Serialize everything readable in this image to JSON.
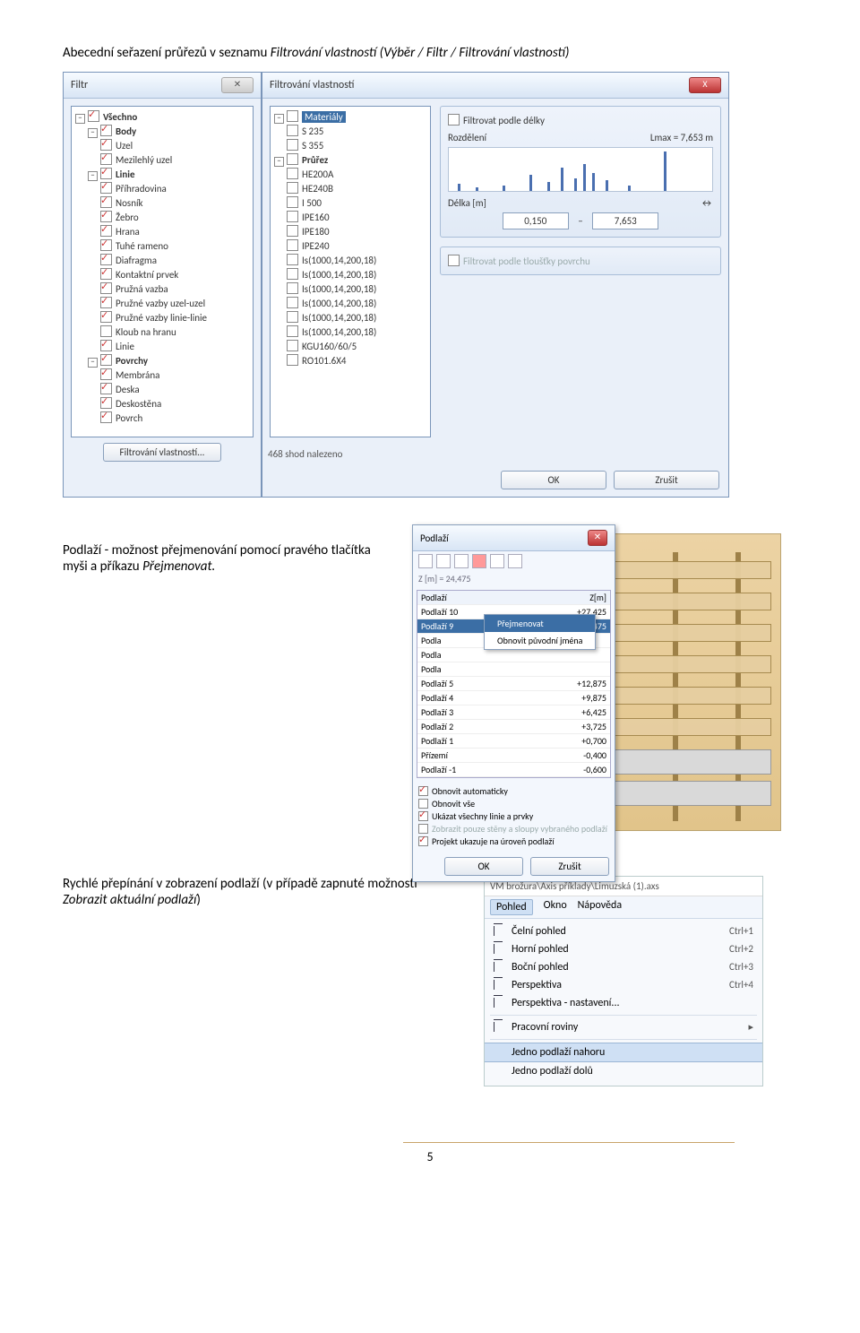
{
  "heading_plain": "Abecední seřazení průřezů v seznamu ",
  "heading_italic": "Filtrování vlastností (Výběr / Filtr / Filtrování vlastností)",
  "filtr_dialog": {
    "title": "Filtr",
    "tree": {
      "root": "Všechno",
      "body": "Body",
      "body_items": [
        "Uzel",
        "Mezilehlý uzel"
      ],
      "linie": "Linie",
      "linie_items": [
        "Příhradovina",
        "Nosník",
        "Žebro",
        "Hrana",
        "Tuhé rameno",
        "Diafragma",
        "Kontaktní prvek",
        "Pružná vazba",
        "Pružné vazby uzel-uzel",
        "Pružné vazby linie-linie",
        "Kloub na hranu",
        "Linie"
      ],
      "povrchy": "Povrchy",
      "povrchy_items": [
        "Membrána",
        "Deska",
        "Deskostěna",
        "Povrch"
      ]
    },
    "button": "Filtrování vlastností..."
  },
  "vlast_dialog": {
    "title": "Filtrování vlastností",
    "close_x": "X",
    "materialy": "Materiály",
    "mat_items": [
      "S 235",
      "S 355"
    ],
    "prurez": "Průřez",
    "prurez_items": [
      "HE200A",
      "HE240B",
      "I 500",
      "IPE160",
      "IPE180",
      "IPE240",
      "Is(1000,14,200,18)",
      "Is(1000,14,200,18)",
      "Is(1000,14,200,18)",
      "Is(1000,14,200,18)",
      "Is(1000,14,200,18)",
      "Is(1000,14,200,18)",
      "KGU160/60/5",
      "RO101.6X4"
    ],
    "status": "468 shod nalezeno",
    "filter_len": "Filtrovat podle délky",
    "rozdeleni": "Rozdělení",
    "lmax_label": "Lmax",
    "lmax_eq": "= 7,653 m",
    "delka": "Délka [m]",
    "d_from": "0,150",
    "d_to": "7,653",
    "dash": "–",
    "filter_thick": "Filtrovat podle tloušťky povrchu",
    "ok": "OK",
    "cancel": "Zrušit"
  },
  "sec2_text1": "Podlaží - možnost přejmenování pomocí pravého tlačítka myši a příkazu ",
  "sec2_text_italic": "Přejmenovat.",
  "podlazi_panel": {
    "title": "Podlaží",
    "z_label": "Z [m] = 24,475",
    "head_name": "Podlaží",
    "head_z": "Z[m]",
    "rows": [
      {
        "n": "Podlaží 10",
        "z": "+27,425"
      },
      {
        "n": "Podlaží 9",
        "z": "+24,475"
      },
      {
        "n": "Podla",
        "z": ""
      },
      {
        "n": "Podla",
        "z": ""
      },
      {
        "n": "Podla",
        "z": ""
      },
      {
        "n": "Podlaží 5",
        "z": "+12,875"
      },
      {
        "n": "Podlaží 4",
        "z": "+9,875"
      },
      {
        "n": "Podlaží 3",
        "z": "+6,425"
      },
      {
        "n": "Podlaží 2",
        "z": "+3,725"
      },
      {
        "n": "Podlaží 1",
        "z": "+0,700"
      },
      {
        "n": "Přízemí",
        "z": "-0,400"
      },
      {
        "n": "Podlaží -1",
        "z": "-0,600"
      }
    ],
    "ctx_rename": "Přejmenovat",
    "ctx_restore": "Obnovit původní jména",
    "opt1": "Obnovit automaticky",
    "opt2": "Obnovit vše",
    "opt3": "Ukázat všechny linie a prvky",
    "opt4": "Zobrazit pouze stěny a sloupy vybraného podlaží",
    "opt5": "Projekt ukazuje na úroveň podlaží",
    "ok": "OK",
    "cancel": "Zrušit"
  },
  "sec3_text1": "Rychlé přepínání v zobrazení podlaží (v případě zapnuté možnosti ",
  "sec3_text_italic": "Zobrazit aktuální podlaží",
  "sec3_text2": ")",
  "menu3": {
    "path": "VM brožura\\Axis příklady\\Limuzská (1).axs",
    "tabs": [
      "Pohled",
      "Okno",
      "Nápověda"
    ],
    "items": [
      {
        "label": "Čelní pohled",
        "sc": "Ctrl+1"
      },
      {
        "label": "Horní pohled",
        "sc": "Ctrl+2"
      },
      {
        "label": "Boční pohled",
        "sc": "Ctrl+3"
      },
      {
        "label": "Perspektiva",
        "sc": "Ctrl+4"
      },
      {
        "label": "Perspektiva - nastavení...",
        "sc": ""
      }
    ],
    "workplanes": "Pracovní roviny",
    "arrow": "▸",
    "up": "Jedno podlaží nahoru",
    "down": "Jedno podlaží dolů"
  },
  "page_number": "5"
}
